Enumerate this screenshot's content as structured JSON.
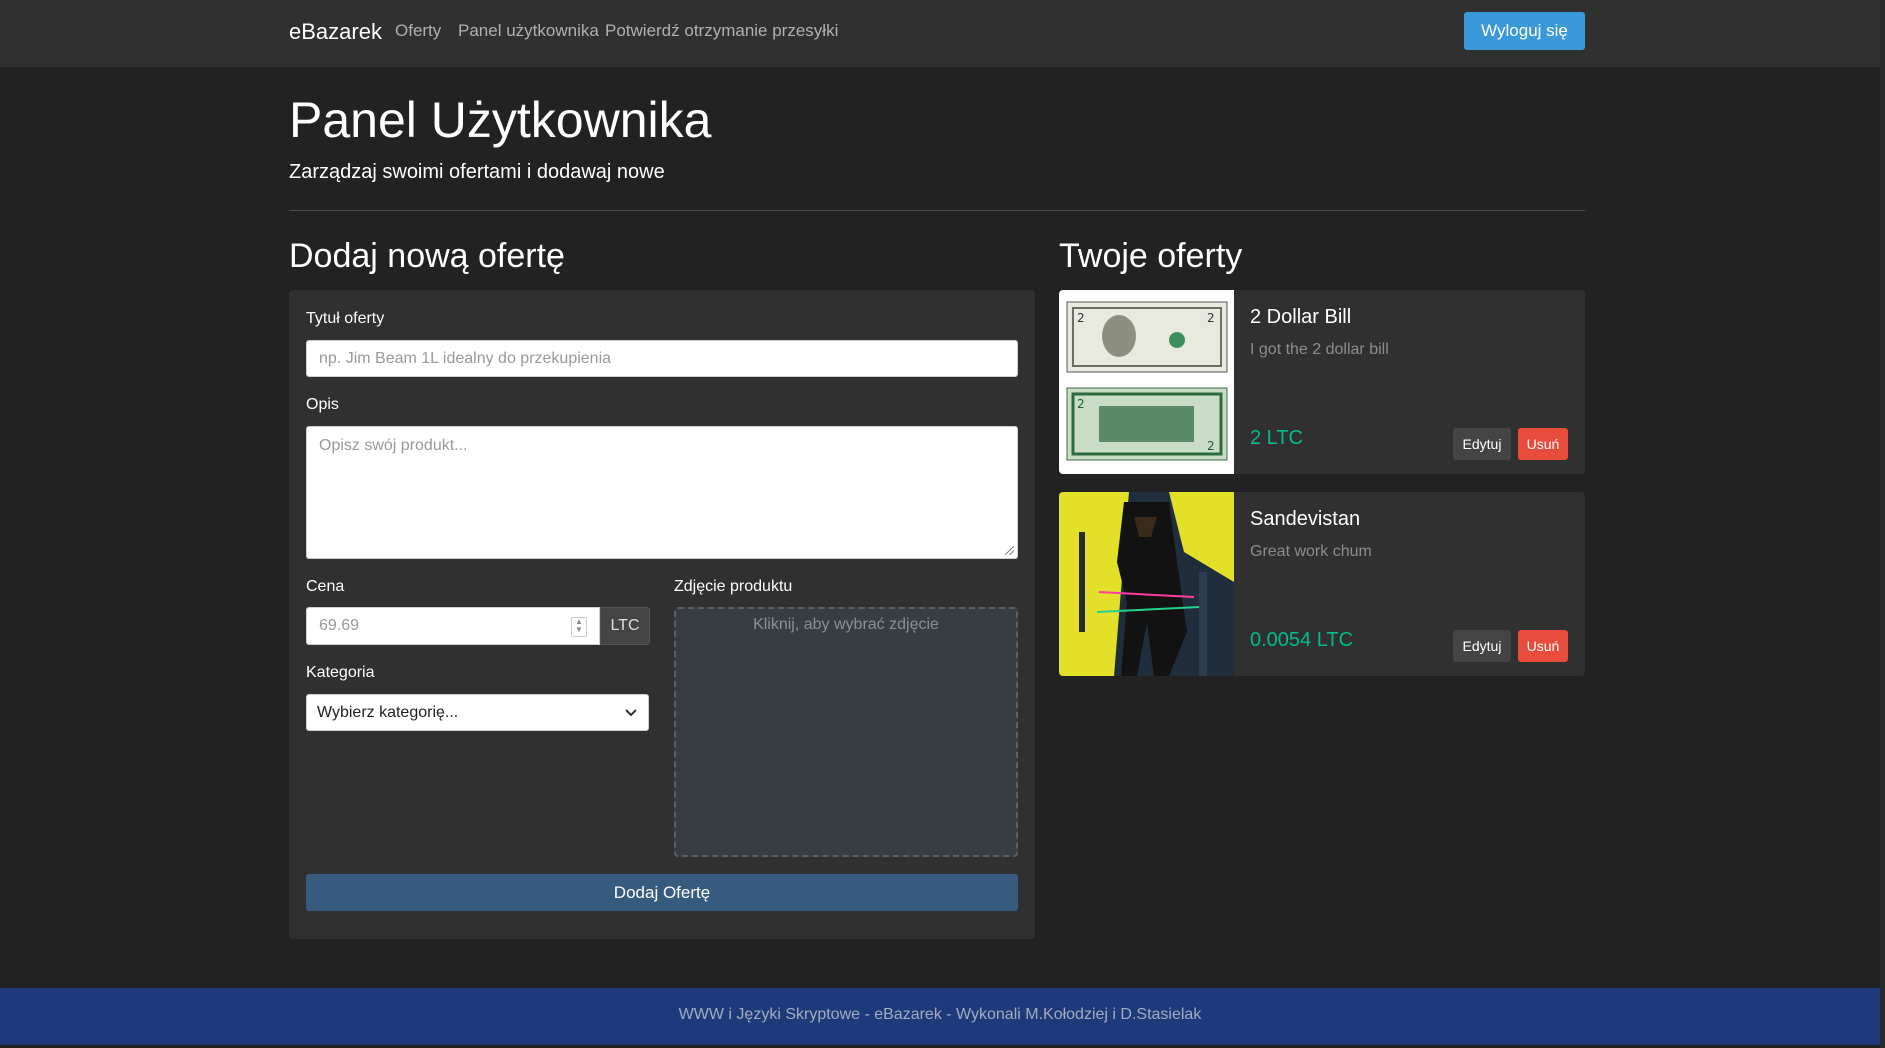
{
  "navbar": {
    "brand": "eBazarek",
    "links": [
      "Oferty",
      "Panel użytkownika",
      "Potwierdź otrzymanie przesyłki"
    ],
    "logout_label": "Wyloguj się"
  },
  "header": {
    "title": "Panel Użytkownika",
    "subtitle": "Zarządzaj swoimi ofertami i dodawaj nowe"
  },
  "form": {
    "section_title": "Dodaj nową ofertę",
    "title_label": "Tytuł oferty",
    "title_placeholder": "np. Jim Beam 1L idealny do przekupienia",
    "description_label": "Opis",
    "description_placeholder": "Opisz swój produkt...",
    "price_label": "Cena",
    "price_placeholder": "69.69",
    "currency": "LTC",
    "category_label": "Kategoria",
    "category_selected": "Wybierz kategorię...",
    "image_label": "Zdjęcie produktu",
    "image_hint": "Kliknij, aby wybrać zdjęcie",
    "submit_label": "Dodaj Ofertę"
  },
  "offers": {
    "section_title": "Twoje oferty",
    "items": [
      {
        "title": "2 Dollar Bill",
        "description": "I got the 2 dollar bill",
        "price": "2 LTC",
        "edit_label": "Edytuj",
        "delete_label": "Usuń"
      },
      {
        "title": "Sandevistan",
        "description": "Great work chum",
        "price": "0.0054 LTC",
        "edit_label": "Edytuj",
        "delete_label": "Usuń"
      }
    ]
  },
  "footer": {
    "text": "WWW i Języki Skryptowe - eBazarek - Wykonali M.Kołodziej i D.Stasielak"
  },
  "colors": {
    "background": "#222222",
    "navbar": "#303030",
    "primary": "#3a9ad9",
    "submit": "#375a7f",
    "price": "#00bc8c",
    "danger": "#e74c3c",
    "footer": "#1e3a7b"
  }
}
